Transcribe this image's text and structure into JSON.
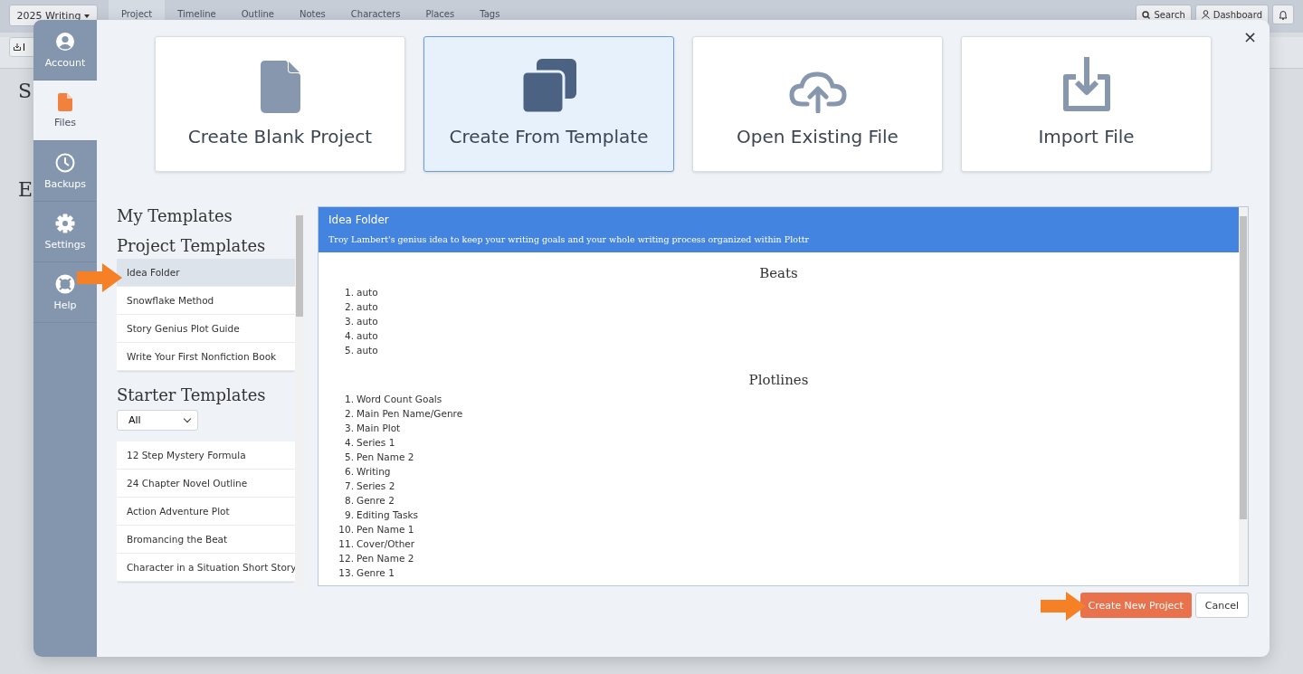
{
  "app_bar": {
    "project_menu": "2025 Writing",
    "tabs": [
      {
        "label": "Project",
        "selected": true
      },
      {
        "label": "Timeline",
        "selected": false
      },
      {
        "label": "Outline",
        "selected": false
      },
      {
        "label": "Notes",
        "selected": false
      },
      {
        "label": "Characters",
        "selected": false
      },
      {
        "label": "Places",
        "selected": false
      },
      {
        "label": "Tags",
        "selected": false
      }
    ],
    "search": "Search",
    "dashboard": "Dashboard",
    "import_button": "I",
    "heading_fragments": [
      "S",
      "E"
    ]
  },
  "dialog": {
    "nav": [
      {
        "kind": "account",
        "label": "Account",
        "selected": false
      },
      {
        "kind": "files",
        "label": "Files",
        "selected": true
      },
      {
        "kind": "backups",
        "label": "Backups",
        "selected": false
      },
      {
        "kind": "settings",
        "label": "Settings",
        "selected": false
      },
      {
        "kind": "help",
        "label": "Help",
        "selected": false
      }
    ],
    "actions": [
      {
        "kind": "blank",
        "label": "Create Blank Project",
        "selected": false
      },
      {
        "kind": "template",
        "label": "Create From Template",
        "selected": true
      },
      {
        "kind": "open",
        "label": "Open Existing File",
        "selected": false
      },
      {
        "kind": "import",
        "label": "Import File",
        "selected": false
      }
    ],
    "my_templates": "My Templates",
    "project_templates": {
      "title": "Project Templates",
      "items": [
        {
          "label": "Idea Folder",
          "selected": true
        },
        {
          "label": "Snowflake Method",
          "selected": false
        },
        {
          "label": "Story Genius Plot Guide",
          "selected": false
        },
        {
          "label": "Write Your First Nonfiction Book",
          "selected": false
        }
      ]
    },
    "starter_templates": {
      "title": "Starter Templates",
      "filter": "All",
      "items": [
        {
          "label": "12 Step Mystery Formula",
          "selected": false
        },
        {
          "label": "24 Chapter Novel Outline",
          "selected": false
        },
        {
          "label": "Action Adventure Plot",
          "selected": false
        },
        {
          "label": "Bromancing the Beat",
          "selected": false
        },
        {
          "label": "Character in a Situation Short Story",
          "selected": false
        }
      ]
    },
    "preview": {
      "title": "Idea Folder",
      "description": "Troy Lambert's genius idea to keep your writing goals and your whole writing process organized within Plottr",
      "sections": [
        {
          "heading": "Beats",
          "items": [
            {
              "number": "1.",
              "text": "auto"
            },
            {
              "number": "2.",
              "text": "auto"
            },
            {
              "number": "3.",
              "text": "auto"
            },
            {
              "number": "4.",
              "text": "auto"
            },
            {
              "number": "5.",
              "text": "auto"
            }
          ]
        },
        {
          "heading": "Plotlines",
          "items": [
            {
              "number": "1.",
              "text": "Word Count Goals"
            },
            {
              "number": "2.",
              "text": "Main Pen Name/Genre"
            },
            {
              "number": "3.",
              "text": "Main Plot"
            },
            {
              "number": "4.",
              "text": "Series 1"
            },
            {
              "number": "5.",
              "text": "Pen Name 2"
            },
            {
              "number": "6.",
              "text": "Writing"
            },
            {
              "number": "7.",
              "text": "Series 2"
            },
            {
              "number": "8.",
              "text": "Genre 2"
            },
            {
              "number": "9.",
              "text": "Editing Tasks"
            },
            {
              "number": "10.",
              "text": "Pen Name 1"
            },
            {
              "number": "11.",
              "text": "Cover/Other"
            },
            {
              "number": "12.",
              "text": "Pen Name 2"
            },
            {
              "number": "13.",
              "text": "Genre 1"
            }
          ]
        }
      ]
    },
    "buttons": {
      "primary": "Create New Project",
      "cancel": "Cancel",
      "close": "×"
    }
  }
}
